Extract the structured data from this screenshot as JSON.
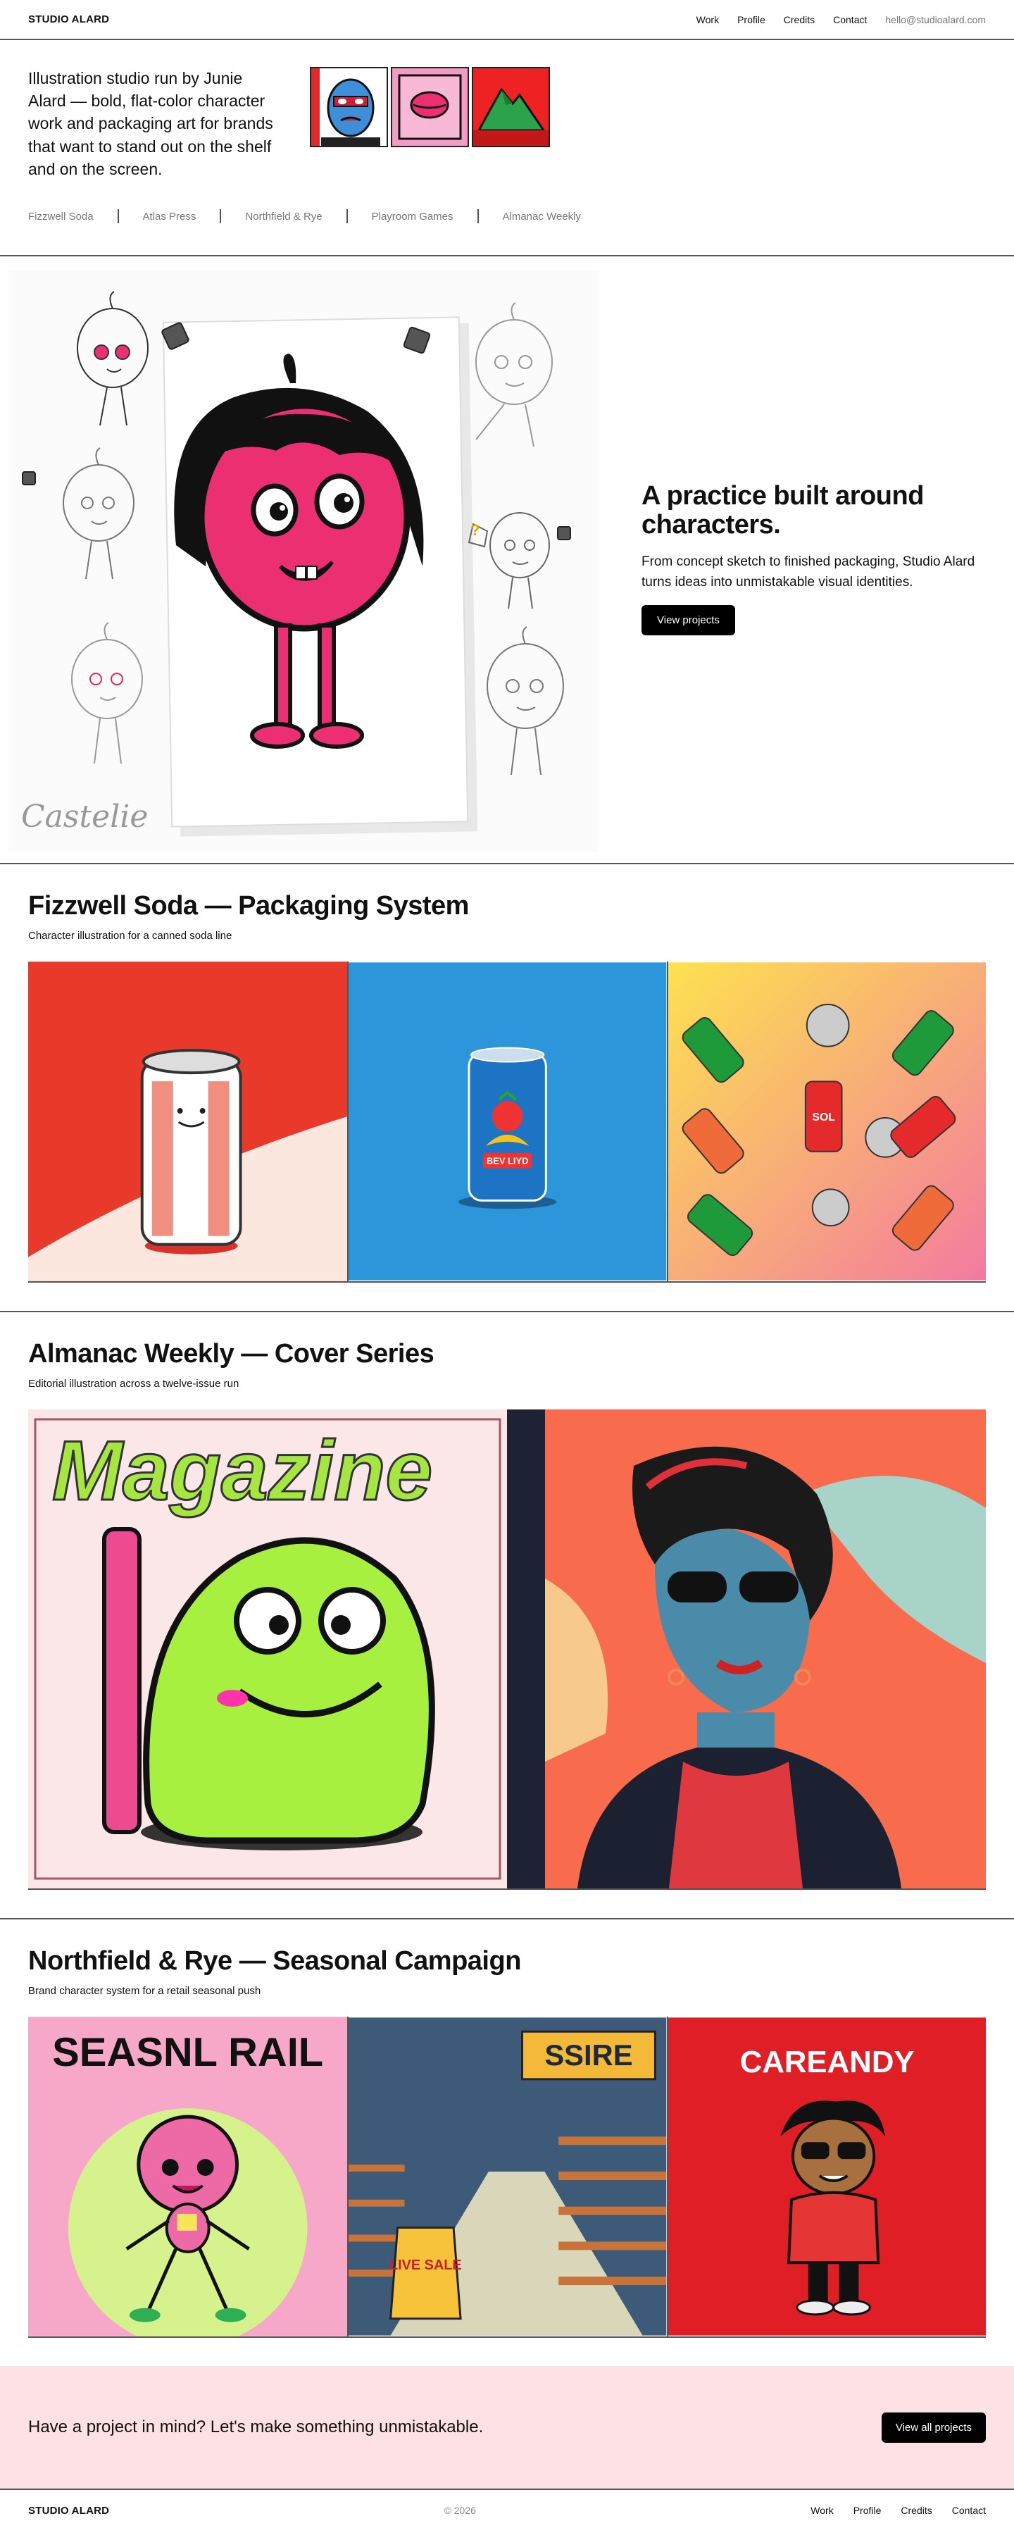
{
  "header": {
    "brand": "STUDIO ALARD",
    "nav": [
      "Work",
      "Profile",
      "Credits",
      "Contact"
    ],
    "email": "hello@studioalard.com"
  },
  "intro": {
    "tagline": "Illustration studio run by Junie Alard — bold, flat-color character work and packaging art for brands that want to stand out on the shelf and on the screen.",
    "clients": [
      "Fizzwell Soda",
      "Atlas Press",
      "Northfield & Rye",
      "Playroom Games",
      "Almanac Weekly"
    ]
  },
  "hero": {
    "heading": "A practice built around characters.",
    "body": "From concept sketch to finished packaging, Studio Alard turns ideas into unmistakable visual identities.",
    "button": "View projects",
    "signature": "Castelie"
  },
  "projects": [
    {
      "title": "Fizzwell Soda — Packaging System",
      "subtitle": "Character illustration for a canned soda line",
      "image_text": [
        "BEV LIYD",
        "SOL"
      ]
    },
    {
      "title": "Almanac Weekly — Cover Series",
      "subtitle": "Editorial illustration across a twelve-issue run",
      "image_text": [
        "Magazine"
      ]
    },
    {
      "title": "Northfield & Rye — Seasonal Campaign",
      "subtitle": "Brand character system for a retail seasonal push",
      "image_text": [
        "SEASNL RAIL",
        "SSIRE",
        "LIVE SALE",
        "CAREANDY"
      ]
    }
  ],
  "cta": {
    "text": "Have a project in mind? Let's make something unmistakable.",
    "button": "View all projects"
  },
  "footer": {
    "brand": "STUDIO ALARD",
    "year": "© 2026",
    "nav": [
      "Work",
      "Profile",
      "Credits",
      "Contact"
    ]
  },
  "colors": {
    "accent_pink": "#ec2f73",
    "cta_bg": "#fde1e4",
    "button": "#000000"
  }
}
